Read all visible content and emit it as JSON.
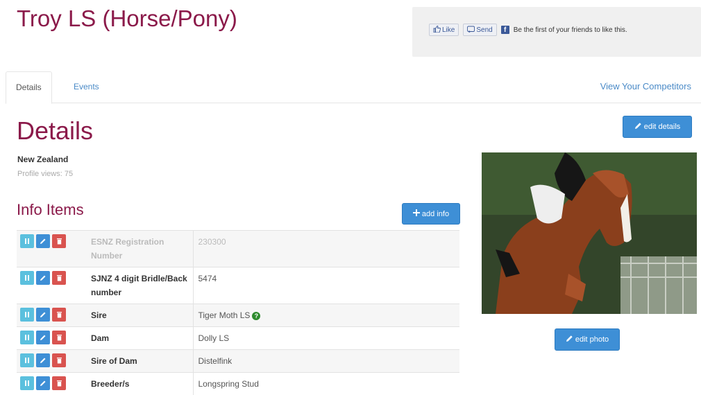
{
  "page": {
    "title": "Troy LS (Horse/Pony)"
  },
  "facebook": {
    "like_label": "Like",
    "send_label": "Send",
    "social_text": "Be the first of your friends to like this."
  },
  "tabs": [
    {
      "label": "Details"
    },
    {
      "label": "Events"
    }
  ],
  "tabs_right_link": "View Your Competitors",
  "details": {
    "heading": "Details",
    "edit_label": "edit details",
    "country": "New Zealand",
    "profile_views": "Profile views: 75"
  },
  "info": {
    "heading": "Info Items",
    "add_label": "add info",
    "rows": [
      {
        "label": "ESNZ Registration Number",
        "value": "230300"
      },
      {
        "label": "SJNZ 4 digit Bridle/Back number",
        "value": "5474"
      },
      {
        "label": "Sire",
        "value": "Tiger Moth LS"
      },
      {
        "label": "Dam",
        "value": "Dolly LS"
      },
      {
        "label": "Sire of Dam",
        "value": "Distelfink"
      },
      {
        "label": "Breeder/s",
        "value": "Longspring Stud"
      }
    ]
  },
  "photo": {
    "edit_label": "edit photo"
  },
  "colors": {
    "accent": "#8b1a4a",
    "primary_button": "#3e8fd6",
    "move_button": "#5bc0de",
    "delete_button": "#d9534f",
    "link": "#4a8ac7"
  },
  "icons": [
    "thumbs-up-icon",
    "send-icon",
    "facebook-icon",
    "pencil-icon",
    "plus-icon",
    "move-icon",
    "trash-icon",
    "info-circle-icon"
  ]
}
